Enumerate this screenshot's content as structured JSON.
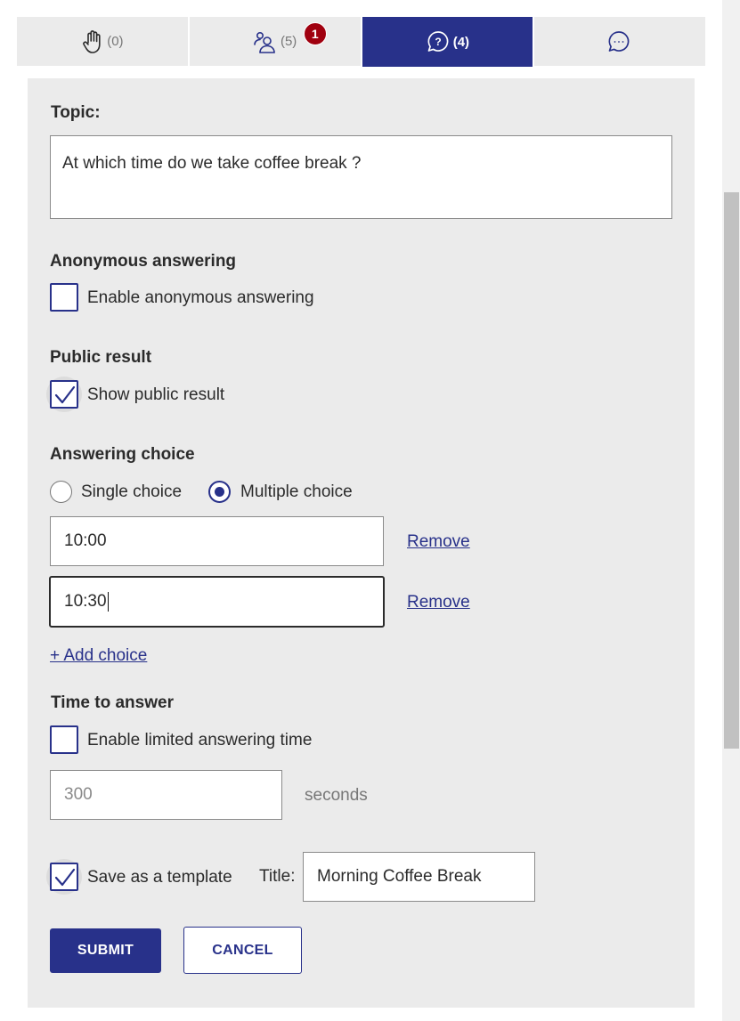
{
  "tabs": [
    {
      "name": "raise-hand",
      "icon": "hand-icon",
      "count": "(0)",
      "active": false
    },
    {
      "name": "participants",
      "icon": "participants-icon",
      "count": "(5)",
      "badge": "1",
      "active": false
    },
    {
      "name": "polls",
      "icon": "question-icon",
      "count": "(4)",
      "active": true
    },
    {
      "name": "chat",
      "icon": "chat-bubble-icon",
      "count": "",
      "active": false
    }
  ],
  "form": {
    "topic_label": "Topic:",
    "topic_value": "At which time do we take coffee break ?",
    "anonymous": {
      "heading": "Anonymous answering",
      "option_label": "Enable anonymous answering",
      "checked": false
    },
    "public_result": {
      "heading": "Public result",
      "option_label": "Show public result",
      "checked": true
    },
    "answering_choice": {
      "heading": "Answering choice",
      "single_label": "Single choice",
      "multiple_label": "Multiple choice",
      "selected": "multiple"
    },
    "choices": [
      {
        "value": "10:00",
        "remove_label": "Remove"
      },
      {
        "value": "10:30",
        "remove_label": "Remove"
      }
    ],
    "add_choice_label": "+ Add choice",
    "time_to_answer": {
      "heading": "Time to answer",
      "option_label": "Enable limited answering time",
      "checked": false,
      "seconds_placeholder": "300",
      "unit_label": "seconds"
    },
    "template": {
      "option_label": "Save as a template",
      "checked": true,
      "title_label": "Title:",
      "title_value": "Morning Coffee Break"
    },
    "submit_label": "SUBMIT",
    "cancel_label": "CANCEL"
  },
  "colors": {
    "accent": "#28318a",
    "badge": "#a0000f",
    "panel_bg": "#ebebeb"
  }
}
